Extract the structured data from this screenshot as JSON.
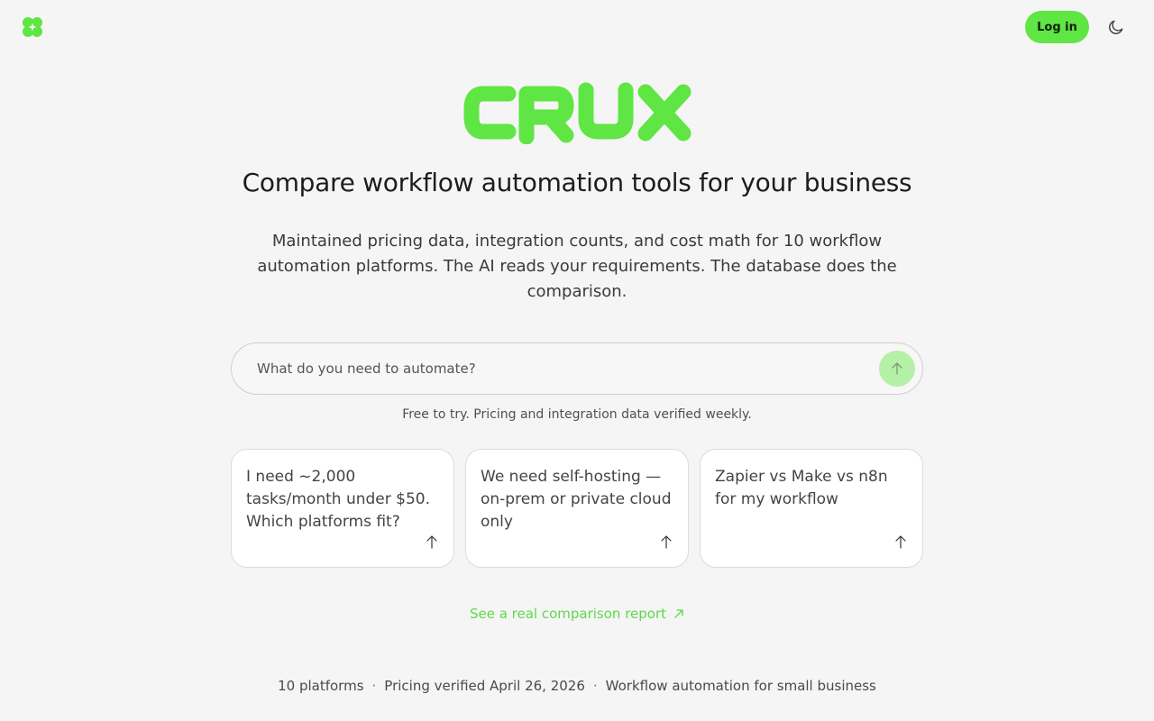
{
  "header": {
    "logo_icon": "four-leaf-logo-icon",
    "login_label": "Log in",
    "theme_icon": "moon-icon"
  },
  "brand": {
    "name": "CRUX"
  },
  "hero": {
    "headline": "Compare workflow automation tools for your business",
    "subhead": "Maintained pricing data, integration counts, and cost math for 10 workflow automation platforms. The AI reads your requirements. The database does the comparison."
  },
  "search": {
    "placeholder": "What do you need to automate?",
    "value": "",
    "submit_icon": "arrow-up-icon"
  },
  "note": "Free to try. Pricing and integration data verified weekly.",
  "suggestions": [
    {
      "text": "I need ~2,000 tasks/month under $50. Which platforms fit?"
    },
    {
      "text": "We need self-hosting — on-prem or private cloud only"
    },
    {
      "text": "Zapier vs Make vs n8n for my workflow"
    }
  ],
  "report_link": {
    "label": "See a real comparison report",
    "icon": "arrow-up-right-icon"
  },
  "footer": {
    "platforms": "10 platforms",
    "verified": "Pricing verified April 26, 2026",
    "tagline": "Workflow automation for small business"
  },
  "colors": {
    "accent": "#5fe544",
    "background": "#f5f5f5",
    "link": "#5ed94a"
  }
}
